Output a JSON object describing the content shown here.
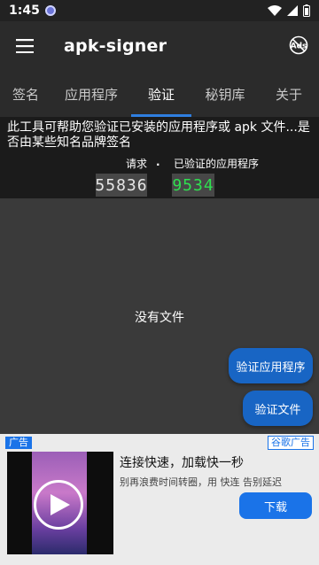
{
  "status_bar": {
    "time": "1:45"
  },
  "app_bar": {
    "title": "apk-signer"
  },
  "tabs": [
    {
      "label": "签名"
    },
    {
      "label": "应用程序"
    },
    {
      "label": "验证",
      "active": true
    },
    {
      "label": "秘钥库"
    },
    {
      "label": "关于"
    }
  ],
  "info": {
    "description": "此工具可帮助您验证已安装的应用程序或 apk 文件...是否由某些知名品牌签名",
    "request_label": "请求",
    "separator": ".",
    "verified_label": "已验证的应用程序",
    "request_count": "55836",
    "verified_count": "9534"
  },
  "content": {
    "empty_text": "没有文件",
    "verify_app_button": "验证应用程序",
    "verify_file_button": "验证文件"
  },
  "ad": {
    "tag": "广告",
    "provider": "谷歌广告",
    "headline": "连接快速，加载快一秒",
    "subtitle": "别再浪费时间转圈，用 快连 告别延迟",
    "cta": "下载"
  },
  "colors": {
    "accent": "#2f7fe0",
    "button": "#1865c4",
    "verified_count": "#2ee04f",
    "ad_button": "#1a73e8"
  }
}
